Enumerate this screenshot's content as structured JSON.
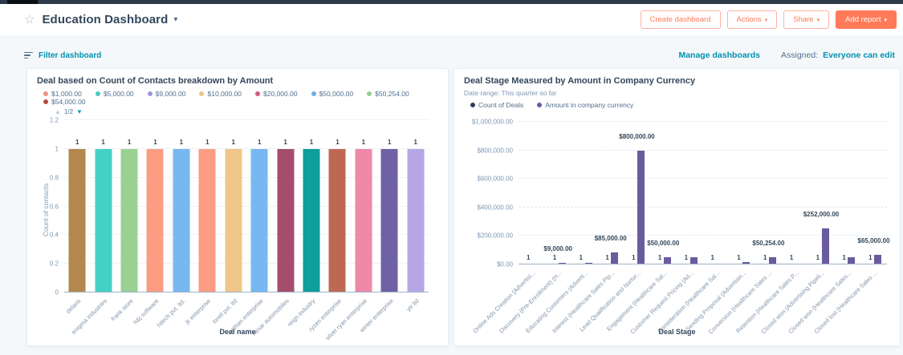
{
  "colors": {
    "accent": "#ff7a59",
    "link": "#0091ae",
    "text-dark": "#33475b",
    "page-bg": "#f5f8fa",
    "card-border": "#e6edf3",
    "bar-purple": "#6a5b9e",
    "topbar": "#2c3a4a"
  },
  "header": {
    "title": "Education Dashboard",
    "buttons": {
      "create": "Create dashboard",
      "actions": "Actions",
      "share": "Share",
      "add_report": "Add report"
    }
  },
  "subbar": {
    "filter": "Filter dashboard",
    "manage": "Manage dashboards",
    "assigned_label": "Assigned:",
    "assigned_value": "Everyone can edit"
  },
  "chart_data": [
    {
      "type": "bar",
      "title": "Deal based on Count of Contacts breakdown by Amount",
      "xlabel": "Deal name",
      "ylabel": "Count of contacts",
      "ylim": [
        0,
        1.2
      ],
      "ytick_values": [
        0,
        0.2,
        0.4,
        0.6,
        0.8,
        1,
        1.2
      ],
      "ytick_labels": [
        "0",
        "0.2",
        "0.4",
        "0.6",
        "0.8",
        "1",
        "1.2"
      ],
      "grid": true,
      "legend_position": "top",
      "legend_pager": "1/2",
      "legend": [
        {
          "label": "$1,000.00",
          "color": "#f0917e"
        },
        {
          "label": "$5,000.00",
          "color": "#4ac9bd"
        },
        {
          "label": "$9,000.00",
          "color": "#a195dc"
        },
        {
          "label": "$10,000.00",
          "color": "#eec488"
        },
        {
          "label": "$20,000.00",
          "color": "#d45b79"
        },
        {
          "label": "$50,000.00",
          "color": "#72abe8"
        },
        {
          "label": "$50,254.00",
          "color": "#98cf92"
        },
        {
          "label": "$54,000.00",
          "color": "#b44c3c"
        }
      ],
      "categories": [
        "delaris",
        "enigma industries",
        "frank store",
        "h&j software",
        "hitech pvt. ltd.",
        "jk enterprise",
        "lorell pvt. ltd",
        "nathan enterprise",
        "nesar automobiles",
        "reign industry",
        "ryzen enterprise",
        "silver ryan enterprise",
        "winter enterprise",
        "ytr ltd"
      ],
      "values": [
        1,
        1,
        1,
        1,
        1,
        1,
        1,
        1,
        1,
        1,
        1,
        1,
        1,
        1
      ],
      "bar_labels": [
        "1",
        "1",
        "1",
        "1",
        "1",
        "1",
        "1",
        "1",
        "1",
        "1",
        "1",
        "1",
        "1",
        "1"
      ],
      "bar_colors": [
        "#b3874d",
        "#45d0c5",
        "#9ad193",
        "#fb9c83",
        "#77b7f2",
        "#fb9c83",
        "#f0c689",
        "#77b7f2",
        "#a44d6c",
        "#0f9e99",
        "#bd6952",
        "#f088a8",
        "#6f61a5",
        "#b7a6e5"
      ]
    },
    {
      "type": "bar",
      "title": "Deal Stage Measured by Amount in Company Currency",
      "subtitle": "Date range: This quarter so far",
      "xlabel": "Deal Stage",
      "ylabel": "",
      "ylim": [
        0,
        1000000
      ],
      "ytick_values": [
        0,
        200000,
        400000,
        600000,
        800000,
        1000000
      ],
      "ytick_labels": [
        "$0.00",
        "$200,000.00",
        "$400,000.00",
        "$600,000.00",
        "$800,000.00",
        "$1,000,000.00"
      ],
      "grid": true,
      "legend_position": "top",
      "legend": [
        {
          "label": "Count of Deals",
          "color": "#2e3f5d"
        },
        {
          "label": "Amount in company currency",
          "color": "#6a5b9e"
        }
      ],
      "categories": [
        "Online Ads Creation (Advertisi...",
        "Discovery (Pre-Enrollment) (H...",
        "Educating Customers (Adverti...",
        "Interest (Healthcare Sales Pip...",
        "Lead Qualification and Nurtur...",
        "Engagement (Healthcare Sal...",
        "Customer Request Pricing (Ad...",
        "Consideration (Healthcare Sal...",
        "Sending Proposal (Advertisin...",
        "Conversion (Healthcare Sales ...",
        "Retention (Healthcare Sales P...",
        "Closed won (Advertising Pipeli...",
        "Closed won (Healthcare Sales...",
        "Closed lost (Healthcare Sales ..."
      ],
      "series": [
        {
          "name": "Count of Deals",
          "values": [
            1,
            1,
            1,
            1,
            1,
            1,
            1,
            1,
            1,
            1,
            1,
            1,
            1,
            1
          ],
          "labels": [
            "1",
            "1",
            "1",
            "1",
            "1",
            "1",
            "1",
            "1",
            "1",
            "1",
            "1",
            "1",
            "1",
            "1"
          ]
        },
        {
          "name": "Amount in company currency",
          "values": [
            0,
            9000,
            9000,
            85000,
            800000,
            50000,
            50000,
            0,
            18000,
            50254,
            0,
            252000,
            50000,
            65000
          ],
          "labels": [
            "",
            "$9,000.00",
            "",
            "$85,000.00",
            "$800,000.00",
            "$50,000.00",
            "",
            "",
            "",
            "$50,254.00",
            "",
            "$252,000.00",
            "",
            "$65,000.00"
          ]
        }
      ]
    }
  ]
}
